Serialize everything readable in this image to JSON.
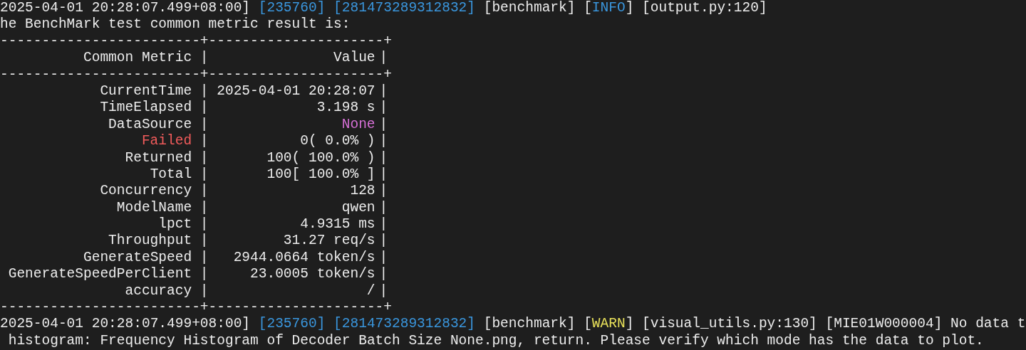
{
  "terminal": {
    "lines": [
      {
        "kind": "log",
        "segments": [
          {
            "text": "2025-04-01 20:28:07.499+08:00] "
          },
          {
            "text": "[235760] [281473289312832]",
            "color": "#3a96dd"
          },
          {
            "text": " [benchmark] ["
          },
          {
            "text": "INFO",
            "color": "#3a96dd"
          },
          {
            "text": "] [output.py:120]"
          }
        ]
      },
      {
        "kind": "log",
        "segments": [
          {
            "text": "he BenchMark test common metric result is:"
          }
        ]
      },
      {
        "kind": "rule",
        "text": "------------------------+---------------------+"
      },
      {
        "kind": "row",
        "cells": [
          {
            "text": "Common Metric"
          },
          {
            "text": "|"
          },
          {
            "text": "Value"
          },
          {
            "text": "|"
          }
        ]
      },
      {
        "kind": "rule",
        "text": "------------------------+---------------------+"
      },
      {
        "kind": "row",
        "cells": [
          {
            "text": "CurrentTime"
          },
          {
            "text": "|"
          },
          {
            "text": "2025-04-01 20:28:07"
          },
          {
            "text": "|"
          }
        ]
      },
      {
        "kind": "row",
        "cells": [
          {
            "text": "TimeElapsed"
          },
          {
            "text": "|"
          },
          {
            "text": "3.198 s"
          },
          {
            "text": "|"
          }
        ]
      },
      {
        "kind": "row",
        "cells": [
          {
            "text": "DataSource"
          },
          {
            "text": "|"
          },
          {
            "text": "None",
            "color": "#d670d6"
          },
          {
            "text": "|"
          }
        ]
      },
      {
        "kind": "row",
        "cells": [
          {
            "text": "Failed",
            "color": "#f05b5b"
          },
          {
            "text": "|"
          },
          {
            "text": "0( 0.0% )"
          },
          {
            "text": "|"
          }
        ]
      },
      {
        "kind": "row",
        "cells": [
          {
            "text": "Returned"
          },
          {
            "text": "|"
          },
          {
            "text": "100( 100.0% )"
          },
          {
            "text": "|"
          }
        ]
      },
      {
        "kind": "row",
        "cells": [
          {
            "text": "Total"
          },
          {
            "text": "|"
          },
          {
            "text": "100[ 100.0% ]"
          },
          {
            "text": "|"
          }
        ]
      },
      {
        "kind": "row",
        "cells": [
          {
            "text": "Concurrency"
          },
          {
            "text": "|"
          },
          {
            "text": "128"
          },
          {
            "text": "|"
          }
        ]
      },
      {
        "kind": "row",
        "cells": [
          {
            "text": "ModelName"
          },
          {
            "text": "|"
          },
          {
            "text": "qwen"
          },
          {
            "text": "|"
          }
        ]
      },
      {
        "kind": "row",
        "cells": [
          {
            "text": "lpct"
          },
          {
            "text": "|"
          },
          {
            "text": "4.9315 ms"
          },
          {
            "text": "|"
          }
        ]
      },
      {
        "kind": "row",
        "cells": [
          {
            "text": "Throughput"
          },
          {
            "text": "|"
          },
          {
            "text": "31.27 req/s"
          },
          {
            "text": "|"
          }
        ]
      },
      {
        "kind": "row",
        "cells": [
          {
            "text": "GenerateSpeed"
          },
          {
            "text": "|"
          },
          {
            "text": "2944.0664 token/s"
          },
          {
            "text": "|"
          }
        ]
      },
      {
        "kind": "row",
        "cells": [
          {
            "text": "GenerateSpeedPerClient"
          },
          {
            "text": "|"
          },
          {
            "text": "23.0005 token/s"
          },
          {
            "text": "|"
          }
        ]
      },
      {
        "kind": "row",
        "cells": [
          {
            "text": "accuracy"
          },
          {
            "text": "|"
          },
          {
            "text": "/"
          },
          {
            "text": "|"
          }
        ]
      },
      {
        "kind": "rule",
        "text": "------------------------+---------------------+"
      },
      {
        "kind": "log",
        "segments": [
          {
            "text": "2025-04-01 20:28:07.499+08:00] "
          },
          {
            "text": "[235760] [281473289312832]",
            "color": "#3a96dd"
          },
          {
            "text": " [benchmark] ["
          },
          {
            "text": "WARN",
            "color": "#e8e05a"
          },
          {
            "text": "] [visual_utils.py:130] [MIE01W000004] No data t"
          }
        ]
      },
      {
        "kind": "log",
        "segments": [
          {
            "text": " histogram: Frequency Histogram of Decoder Batch Size None.png, return. Please verify which mode has the data to plot."
          }
        ]
      }
    ]
  }
}
